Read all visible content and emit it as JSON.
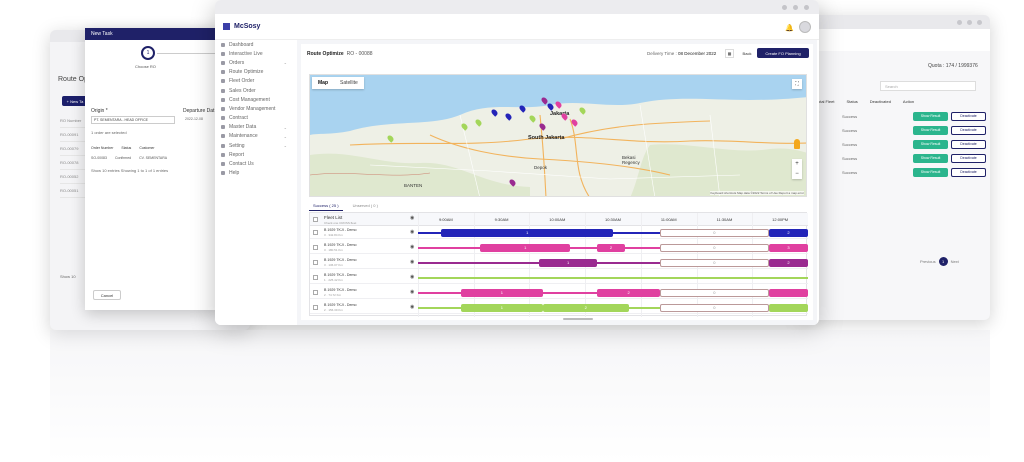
{
  "left_window": {
    "title": "Route Opt",
    "new_btn": "+ New Ta",
    "col": "RO Number",
    "rows": [
      "RO-00091",
      "RO-00079",
      "RO-00078",
      "RO-00052",
      "RO-00051"
    ],
    "show": "Show 10"
  },
  "modal": {
    "header": "New Task",
    "step_num": "1",
    "step_label": "Choose RO",
    "origin_label": "Origin *",
    "origin_value": "PT. SEMENTARA - HEAD OFFICE",
    "departure_label": "Departure Dat",
    "departure_value": "2022-12-08",
    "selected_text": "1 order are selected",
    "headers": [
      "Order Number",
      "Status",
      "Customer"
    ],
    "row": [
      "SO-00083",
      "Confirmed",
      "CV. SEMENTARA"
    ],
    "entries_text": "Show 10 entries Showing 1 to 1 of 1 entries",
    "cancel": "Cancel"
  },
  "right_window": {
    "quota": "Quota : 174 / 1999376",
    "search_placeholder": "Search",
    "headers": [
      "Total Fleet",
      "Status",
      "Deactivated",
      "Action"
    ],
    "rows": [
      {
        "status": "Success",
        "show": "Show Result",
        "deact": "Deactivate"
      },
      {
        "status": "Success",
        "show": "Show Result",
        "deact": "Deactivate"
      },
      {
        "status": "Success",
        "show": "Show Result",
        "deact": "Deactivate"
      },
      {
        "status": "Success",
        "show": "Show Result",
        "deact": "Deactivate"
      },
      {
        "status": "Success",
        "show": "Show Result",
        "deact": "Deactivate"
      }
    ],
    "pager": {
      "prev": "Previous",
      "current": "1",
      "next": "Next"
    }
  },
  "main": {
    "logo": "McSosy",
    "sidebar": [
      {
        "label": "Dashboard",
        "chevron": false
      },
      {
        "label": "Interactive Live",
        "chevron": false
      },
      {
        "label": "Orders",
        "chevron": true
      },
      {
        "label": "Route Optimize",
        "chevron": false
      },
      {
        "label": "Fleet Order",
        "chevron": false
      },
      {
        "label": "Sales Order",
        "chevron": false
      },
      {
        "label": "Cost Management",
        "chevron": false
      },
      {
        "label": "Vendor Management",
        "chevron": false
      },
      {
        "label": "Contract",
        "chevron": false
      },
      {
        "label": "Master Data",
        "chevron": true
      },
      {
        "label": "Maintenance",
        "chevron": true
      },
      {
        "label": "Setting",
        "chevron": true
      },
      {
        "label": "Report",
        "chevron": false
      },
      {
        "label": "Contact Us",
        "chevron": false
      },
      {
        "label": "Help",
        "chevron": false
      }
    ],
    "route_title": "Route Optimize",
    "route_id": "RO - 00088",
    "delivery_label": "Delivery Time :",
    "delivery_value": "08 December 2022",
    "back": "Back",
    "create": "Create FO Planning",
    "map": {
      "tab_map": "Map",
      "tab_satellite": "Satellite",
      "labels": {
        "jakarta": "Jakarta",
        "south_jakarta": "South Jakarta",
        "depok": "Depok",
        "bogor": "Bogor",
        "banten": "BANTEN",
        "bekasi": "Bekasi Regency",
        "tangerang": "Tangerang",
        "bogor_reg": "Bogor Regency"
      },
      "attribution": "Keyboard shortcuts  Map data ©2022  Terms of Use  Report a map error"
    },
    "tabs": [
      "Success ( 25 )",
      "Unserved ( 0 )"
    ],
    "gantt": {
      "fleet_label": "Fleet List",
      "fleet_sub": "Check one CROSS fleet",
      "times": [
        "9:00AM",
        "9:30AM",
        "10:00AM",
        "10:30AM",
        "11:00AM",
        "11:30AM",
        "12:00PM"
      ],
      "rows": [
        {
          "name": "B 1929 TKJI - Demo",
          "sub": "3  ·  342.84 Km"
        },
        {
          "name": "B 1929 TKJI - Demo",
          "sub": "3  ·  180.51 Km"
        },
        {
          "name": "B 1929 TKJI - Demo",
          "sub": "3  ·  136.07 Km"
        },
        {
          "name": "B 1929 TKJI - Demo",
          "sub": "1  ·  225.42 Km"
        },
        {
          "name": "B 1929 TKJI - Demo",
          "sub": "2  ·  74.72 Km"
        },
        {
          "name": "B 1929 TKJI - Demo",
          "sub": "2  ·  156.39 Km"
        }
      ],
      "segments": [
        [
          {
            "s": 0.0,
            "e": 0.06,
            "c": "#2324b8",
            "t": "",
            "line": true
          },
          {
            "s": 0.06,
            "e": 0.5,
            "c": "#2324b8",
            "t": "1"
          },
          {
            "s": 0.5,
            "e": 0.62,
            "c": "#2324b8",
            "t": "",
            "line": true
          },
          {
            "s": 0.62,
            "e": 0.9,
            "c": "#fff",
            "t": "0",
            "outline": true
          },
          {
            "s": 0.9,
            "e": 1.0,
            "c": "#2324b8",
            "t": "2"
          }
        ],
        [
          {
            "s": 0.0,
            "e": 0.16,
            "c": "#e040a0",
            "t": "",
            "line": true
          },
          {
            "s": 0.16,
            "e": 0.39,
            "c": "#e040a0",
            "t": "1"
          },
          {
            "s": 0.39,
            "e": 0.46,
            "c": "#e040a0",
            "t": "",
            "line": true
          },
          {
            "s": 0.46,
            "e": 0.53,
            "c": "#e040a0",
            "t": "2"
          },
          {
            "s": 0.53,
            "e": 0.62,
            "c": "#e040a0",
            "t": "",
            "line": true
          },
          {
            "s": 0.62,
            "e": 0.9,
            "c": "#fff",
            "t": "0",
            "outline": true
          },
          {
            "s": 0.9,
            "e": 1.0,
            "c": "#e040a0",
            "t": "3"
          }
        ],
        [
          {
            "s": 0.0,
            "e": 0.31,
            "c": "#9a2a90",
            "t": "",
            "line": true
          },
          {
            "s": 0.31,
            "e": 0.46,
            "c": "#9a2a90",
            "t": "1"
          },
          {
            "s": 0.46,
            "e": 0.62,
            "c": "#9a2a90",
            "t": "",
            "line": true
          },
          {
            "s": 0.62,
            "e": 0.9,
            "c": "#fff",
            "t": "0",
            "outline": true
          },
          {
            "s": 0.9,
            "e": 1.0,
            "c": "#9a2a90",
            "t": "2"
          }
        ],
        [
          {
            "s": 0.0,
            "e": 1.0,
            "c": "#a3d65a",
            "t": "",
            "line": true
          }
        ],
        [
          {
            "s": 0.0,
            "e": 0.11,
            "c": "#e040a0",
            "t": "",
            "line": true
          },
          {
            "s": 0.11,
            "e": 0.32,
            "c": "#e040a0",
            "t": "1"
          },
          {
            "s": 0.32,
            "e": 0.46,
            "c": "#e040a0",
            "t": "",
            "line": true
          },
          {
            "s": 0.46,
            "e": 0.62,
            "c": "#e040a0",
            "t": "2"
          },
          {
            "s": 0.62,
            "e": 0.9,
            "c": "#fff",
            "t": "0",
            "outline": true
          },
          {
            "s": 0.9,
            "e": 1.0,
            "c": "#e040a0",
            "t": ""
          }
        ],
        [
          {
            "s": 0.0,
            "e": 0.11,
            "c": "#a3d65a",
            "t": "",
            "line": true
          },
          {
            "s": 0.11,
            "e": 0.32,
            "c": "#a3d65a",
            "t": "1"
          },
          {
            "s": 0.32,
            "e": 0.54,
            "c": "#a3d65a",
            "t": "2"
          },
          {
            "s": 0.54,
            "e": 0.62,
            "c": "#a3d65a",
            "t": "",
            "line": true
          },
          {
            "s": 0.62,
            "e": 0.9,
            "c": "#fff",
            "t": "0",
            "outline": true
          },
          {
            "s": 0.9,
            "e": 1.0,
            "c": "#a3d65a",
            "t": ""
          }
        ]
      ]
    }
  },
  "colors": {
    "brand": "#1f2168",
    "success": "#2bb58d"
  }
}
